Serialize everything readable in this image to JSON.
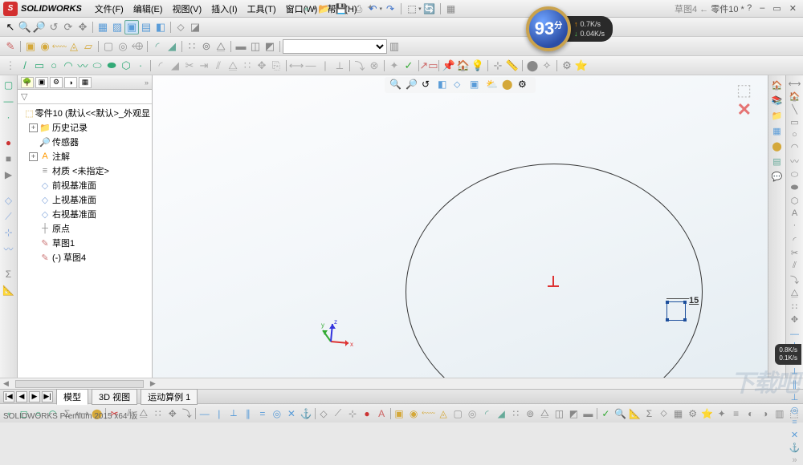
{
  "brand": "SOLIDWORKS",
  "menus": [
    "文件(F)",
    "编辑(E)",
    "视图(V)",
    "插入(I)",
    "工具(T)",
    "窗口(W)",
    "帮助(H)"
  ],
  "doc": {
    "crumb": "草图4 ←",
    "name": "零件10 *"
  },
  "help_icon": "?",
  "badge": {
    "score": "93",
    "suffix": "分",
    "up": "0.7K/s",
    "down": "0.04K/s"
  },
  "tree": {
    "root": "零件10 (默认<<默认>_外观显",
    "items": [
      {
        "exp": "+",
        "icon": "📁",
        "label": "历史记录",
        "color": "#d99"
      },
      {
        "exp": "",
        "icon": "🔎",
        "label": "传感器",
        "color": "#8ad"
      },
      {
        "exp": "+",
        "icon": "A",
        "label": "注解",
        "color": "#f90"
      },
      {
        "exp": "",
        "icon": "≡",
        "label": "材质 <未指定>",
        "color": "#888"
      },
      {
        "exp": "",
        "icon": "◇",
        "label": "前视基准面",
        "color": "#8ad"
      },
      {
        "exp": "",
        "icon": "◇",
        "label": "上视基准面",
        "color": "#8ad"
      },
      {
        "exp": "",
        "icon": "◇",
        "label": "右视基准面",
        "color": "#8ad"
      },
      {
        "exp": "",
        "icon": "┼",
        "label": "原点",
        "color": "#888"
      },
      {
        "exp": "",
        "icon": "✎",
        "label": "草图1",
        "color": "#c77"
      },
      {
        "exp": "",
        "icon": "✎",
        "label": "(-) 草图4",
        "color": "#c77"
      }
    ]
  },
  "dimension": "15",
  "bottomtabs": {
    "t1": "模型",
    "t2": "3D 视图",
    "t3": "运动算例 1"
  },
  "statusline": "SOLIDWORKS Premium 2015 x64 版",
  "filter_placeholder": "▽",
  "netmini": {
    "a": "0.8K/s",
    "b": "0.1K/s"
  },
  "watermark": "下载吧"
}
